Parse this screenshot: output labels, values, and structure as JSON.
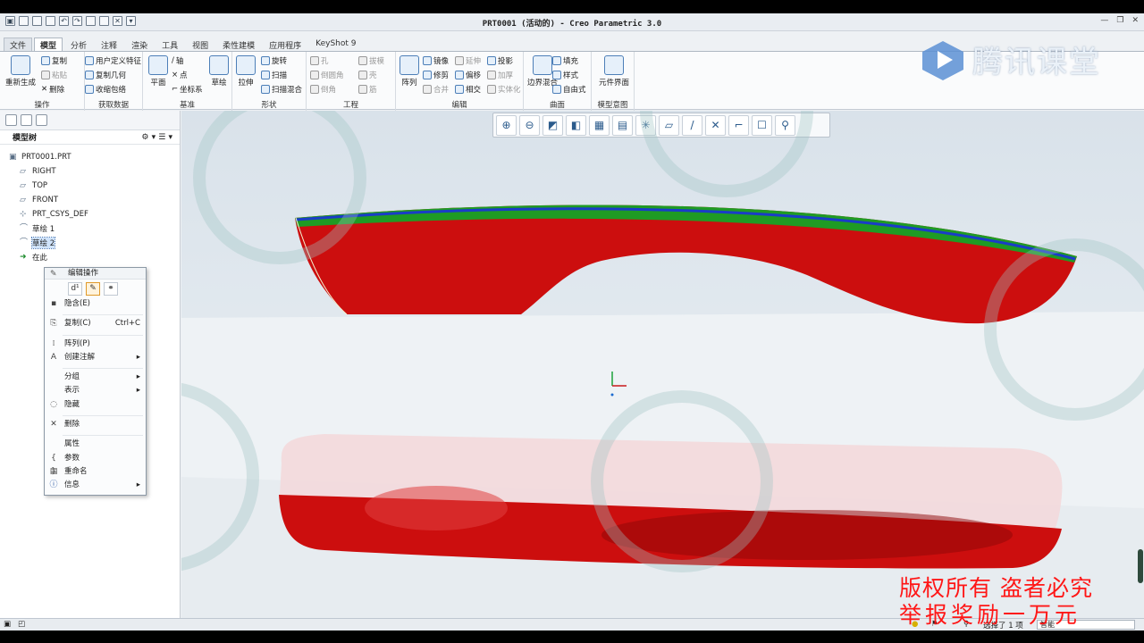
{
  "window": {
    "title": "PRT0001 (活动的) - Creo Parametric 3.0"
  },
  "tabs": [
    "文件",
    "模型",
    "分析",
    "注释",
    "渲染",
    "工具",
    "视图",
    "柔性建模",
    "应用程序",
    "KeyShot 9"
  ],
  "active_tab": "模型",
  "ribbon": {
    "operations": {
      "regen": "重新生成",
      "copy": "复制",
      "paste": "粘贴",
      "delete": "删除",
      "label": "操作"
    },
    "get_data": {
      "udf": "用户定义特征",
      "copy_geom": "复制几何",
      "shrinkwrap": "收缩包络",
      "label": "获取数据"
    },
    "datum": {
      "plane": "平面",
      "axis": "轴",
      "point": "点",
      "csys": "坐标系",
      "sketch": "草绘",
      "label": "基准"
    },
    "shapes": {
      "extrude": "拉伸",
      "revolve": "旋转",
      "sweep": "扫描",
      "blend": "扫描混合",
      "label": "形状"
    },
    "engineering": {
      "hole": "孔",
      "round": "倒圆角",
      "chamfer": "倒角",
      "draft": "拔模",
      "shell": "壳",
      "rib": "筋",
      "label": "工程"
    },
    "editing": {
      "pattern": "阵列",
      "mirror": "镜像",
      "trim": "修剪",
      "extend": "延伸",
      "offset": "偏移",
      "merge": "合并",
      "project": "投影",
      "thicken": "加厚",
      "intersect": "相交",
      "solidify": "实体化",
      "label": "编辑"
    },
    "surfaces": {
      "boundary": "边界混合",
      "fill": "填充",
      "style": "样式",
      "freestyle": "自由式",
      "label": "曲面"
    },
    "model_intent": {
      "component": "元件界面",
      "label": "模型意图"
    }
  },
  "sidebar": {
    "title": "模型树",
    "items": [
      {
        "label": "PRT0001.PRT",
        "icon": "part-icon"
      },
      {
        "label": "RIGHT",
        "icon": "datum-plane-icon"
      },
      {
        "label": "TOP",
        "icon": "datum-plane-icon"
      },
      {
        "label": "FRONT",
        "icon": "datum-plane-icon"
      },
      {
        "label": "PRT_CSYS_DEF",
        "icon": "csys-icon"
      },
      {
        "label": "草绘 1",
        "icon": "sketch-icon"
      },
      {
        "label": "草绘 2",
        "icon": "sketch-icon",
        "selected": true
      },
      {
        "label": "在此",
        "icon": "insert-arrow-icon"
      }
    ]
  },
  "context_menu": {
    "header": "编辑操作",
    "items": [
      {
        "label": "隐含(E)",
        "shortcut": "",
        "icon": "suppress-icon",
        "submenu": false
      },
      {
        "label": "复制(C)",
        "shortcut": "Ctrl+C",
        "icon": "copy-icon",
        "submenu": false
      },
      {
        "label": "阵列(P)",
        "shortcut": "",
        "icon": "pattern-icon",
        "submenu": false
      },
      {
        "label": "创建注解",
        "shortcut": "",
        "icon": "annotation-icon",
        "submenu": true
      },
      {
        "label": "分组",
        "shortcut": "",
        "icon": "",
        "submenu": true
      },
      {
        "label": "表示",
        "shortcut": "",
        "icon": "",
        "submenu": true
      },
      {
        "label": "隐藏",
        "shortcut": "",
        "icon": "hide-icon",
        "submenu": false
      },
      {
        "label": "删除",
        "shortcut": "",
        "icon": "delete-icon",
        "submenu": false
      },
      {
        "label": "属性",
        "shortcut": "",
        "icon": "",
        "submenu": false
      },
      {
        "label": "参数",
        "shortcut": "",
        "icon": "parameters-icon",
        "submenu": false
      },
      {
        "label": "重命名",
        "shortcut": "",
        "icon": "rename-icon",
        "submenu": false
      },
      {
        "label": "信息",
        "shortcut": "",
        "icon": "info-icon",
        "submenu": true
      }
    ]
  },
  "status": {
    "selected": "选择了 1 项",
    "filter": "智能"
  },
  "overlay": {
    "brand": "腾讯课堂",
    "copyright_line1": "版权所有 盗者必究",
    "copyright_line2": "举报奖励一万元"
  },
  "colors": {
    "model_red": "#d01010",
    "model_green": "#1e9e22",
    "model_blue": "#1a3cc8"
  }
}
